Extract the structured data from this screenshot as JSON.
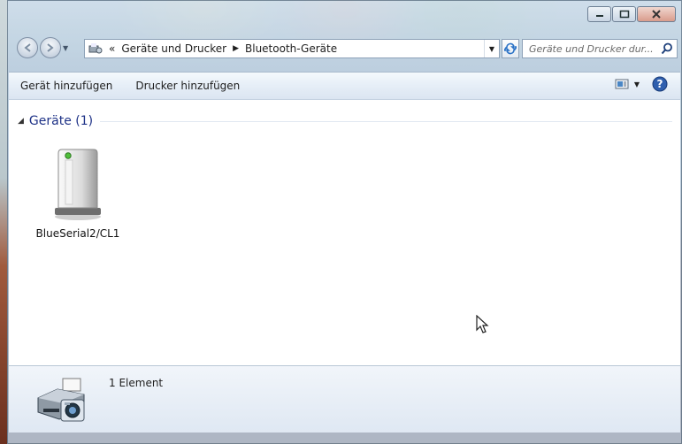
{
  "window": {
    "caption_buttons": [
      "minimize",
      "maximize",
      "close"
    ]
  },
  "address": {
    "overflow": "«",
    "crumbs": [
      "Geräte und Drucker",
      "Bluetooth-Geräte"
    ],
    "search_placeholder": "Geräte und Drucker dur..."
  },
  "toolbar": {
    "add_device": "Gerät hinzufügen",
    "add_printer": "Drucker hinzufügen"
  },
  "group": {
    "title": "Geräte (1)"
  },
  "devices": [
    {
      "label": "BlueSerial2/CL1",
      "icon": "bluetooth-device-tower-icon"
    }
  ],
  "details": {
    "count": "1 Element"
  },
  "colors": {
    "group_header": "#1e3287",
    "toolbar_bg": "#e6eef7",
    "details_bg": "#dfe8f3"
  }
}
